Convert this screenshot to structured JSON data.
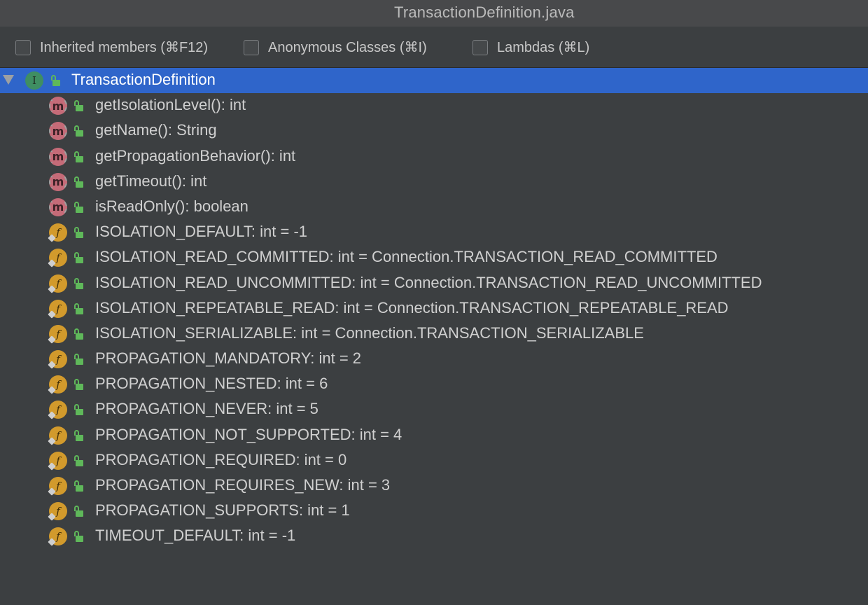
{
  "window": {
    "title": "TransactionDefinition.java"
  },
  "filters": [
    {
      "label": "Inherited members (⌘F12)",
      "checked": false
    },
    {
      "label": "Anonymous Classes (⌘I)",
      "checked": false
    },
    {
      "label": "Lambdas (⌘L)",
      "checked": false
    }
  ],
  "tree": {
    "root": {
      "icon": "interface-icon",
      "icon_letter": "I",
      "label": "TransactionDefinition",
      "expanded": true
    },
    "members": [
      {
        "kind": "method",
        "icon_letter": "m",
        "label": "getIsolationLevel(): int"
      },
      {
        "kind": "method",
        "icon_letter": "m",
        "label": "getName(): String"
      },
      {
        "kind": "method",
        "icon_letter": "m",
        "label": "getPropagationBehavior(): int"
      },
      {
        "kind": "method",
        "icon_letter": "m",
        "label": "getTimeout(): int"
      },
      {
        "kind": "method",
        "icon_letter": "m",
        "label": "isReadOnly(): boolean"
      },
      {
        "kind": "field",
        "icon_letter": "f",
        "label": "ISOLATION_DEFAULT: int = -1"
      },
      {
        "kind": "field",
        "icon_letter": "f",
        "label": "ISOLATION_READ_COMMITTED: int = Connection.TRANSACTION_READ_COMMITTED"
      },
      {
        "kind": "field",
        "icon_letter": "f",
        "label": "ISOLATION_READ_UNCOMMITTED: int = Connection.TRANSACTION_READ_UNCOMMITTED"
      },
      {
        "kind": "field",
        "icon_letter": "f",
        "label": "ISOLATION_REPEATABLE_READ: int = Connection.TRANSACTION_REPEATABLE_READ"
      },
      {
        "kind": "field",
        "icon_letter": "f",
        "label": "ISOLATION_SERIALIZABLE: int = Connection.TRANSACTION_SERIALIZABLE"
      },
      {
        "kind": "field",
        "icon_letter": "f",
        "label": "PROPAGATION_MANDATORY: int = 2"
      },
      {
        "kind": "field",
        "icon_letter": "f",
        "label": "PROPAGATION_NESTED: int = 6"
      },
      {
        "kind": "field",
        "icon_letter": "f",
        "label": "PROPAGATION_NEVER: int = 5"
      },
      {
        "kind": "field",
        "icon_letter": "f",
        "label": "PROPAGATION_NOT_SUPPORTED: int = 4"
      },
      {
        "kind": "field",
        "icon_letter": "f",
        "label": "PROPAGATION_REQUIRED: int = 0"
      },
      {
        "kind": "field",
        "icon_letter": "f",
        "label": "PROPAGATION_REQUIRES_NEW: int = 3"
      },
      {
        "kind": "field",
        "icon_letter": "f",
        "label": "PROPAGATION_SUPPORTS: int = 1"
      },
      {
        "kind": "field",
        "icon_letter": "f",
        "label": "TIMEOUT_DEFAULT: int = -1"
      }
    ]
  },
  "colors": {
    "background": "#3c3f41",
    "selection": "#2f65ca",
    "method_icon": "#c56b78",
    "field_icon": "#d29a2c",
    "interface_icon": "#3f8e62",
    "public_lock": "#5fb85a"
  }
}
